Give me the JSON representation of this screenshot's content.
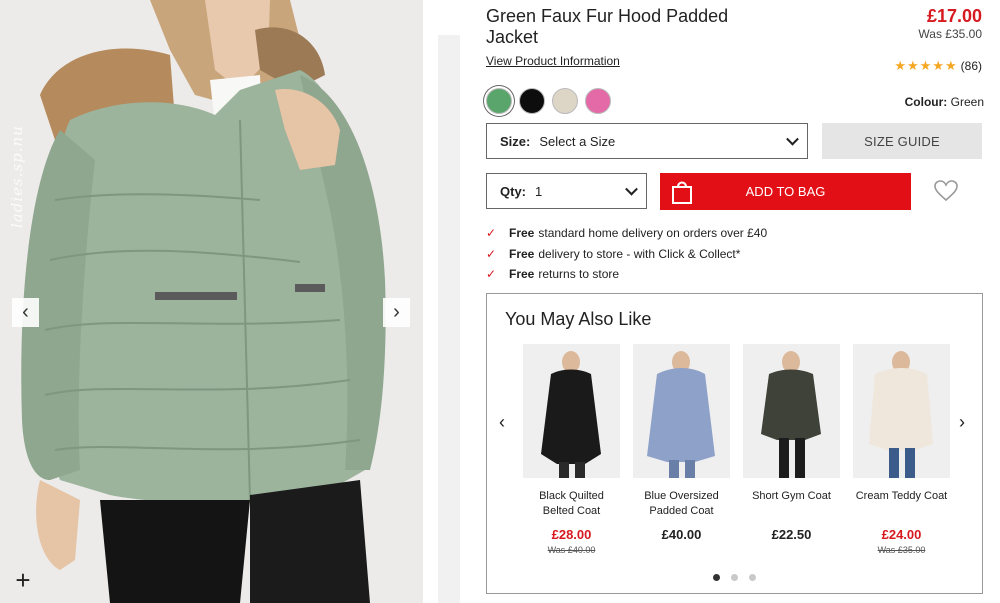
{
  "product": {
    "title": "Green Faux Fur Hood Padded Jacket",
    "price": "£17.00",
    "was_price": "Was £35.00",
    "view_info": "View Product Information",
    "stars": "★★★★★",
    "review_count": "(86)",
    "rating_icon": "star-icon"
  },
  "gallery": {
    "watermark": "ladies.sp.nu",
    "prev": "‹",
    "next": "›",
    "zoom": "+"
  },
  "colours": {
    "label": "Colour:",
    "selected": "Green",
    "swatches": [
      {
        "name": "Green",
        "hex": "#5aa56b"
      },
      {
        "name": "Black",
        "hex": "#0d0d0d"
      },
      {
        "name": "Stone",
        "hex": "#ddd5c6"
      },
      {
        "name": "Pink",
        "hex": "#e36aa7"
      }
    ]
  },
  "size": {
    "label": "Size:",
    "value": "Select a Size",
    "guide": "SIZE GUIDE"
  },
  "qty": {
    "label": "Qty:",
    "value": "1"
  },
  "cart": {
    "add_label": "ADD TO BAG"
  },
  "delivery": [
    {
      "bold": "Free",
      "text": "standard home delivery on orders over £40"
    },
    {
      "bold": "Free",
      "text": "delivery to store - with Click & Collect*"
    },
    {
      "bold": "Free",
      "text": "returns to store"
    }
  ],
  "recommendations": {
    "title": "You May Also Like",
    "prev": "‹",
    "next": "›",
    "items": [
      {
        "name": "Black Quilted Belted Coat",
        "price": "£28.00",
        "was": "Was £40.00",
        "sale": true,
        "colour": "#1a1a1a"
      },
      {
        "name": "Blue Oversized Padded Coat",
        "price": "£40.00",
        "was": "",
        "sale": false,
        "colour": "#8ea1c8"
      },
      {
        "name": "Short Gym Coat",
        "price": "£22.50",
        "was": "",
        "sale": false,
        "colour": "#3f4238"
      },
      {
        "name": "Cream Teddy Coat",
        "price": "£24.00",
        "was": "Was £35.00",
        "sale": true,
        "colour": "#efe7dc"
      }
    ],
    "page_count": 3,
    "active_page": 1
  },
  "colors": {
    "accent": "#e20f16",
    "sale": "#d71920",
    "star": "#f5a623"
  }
}
